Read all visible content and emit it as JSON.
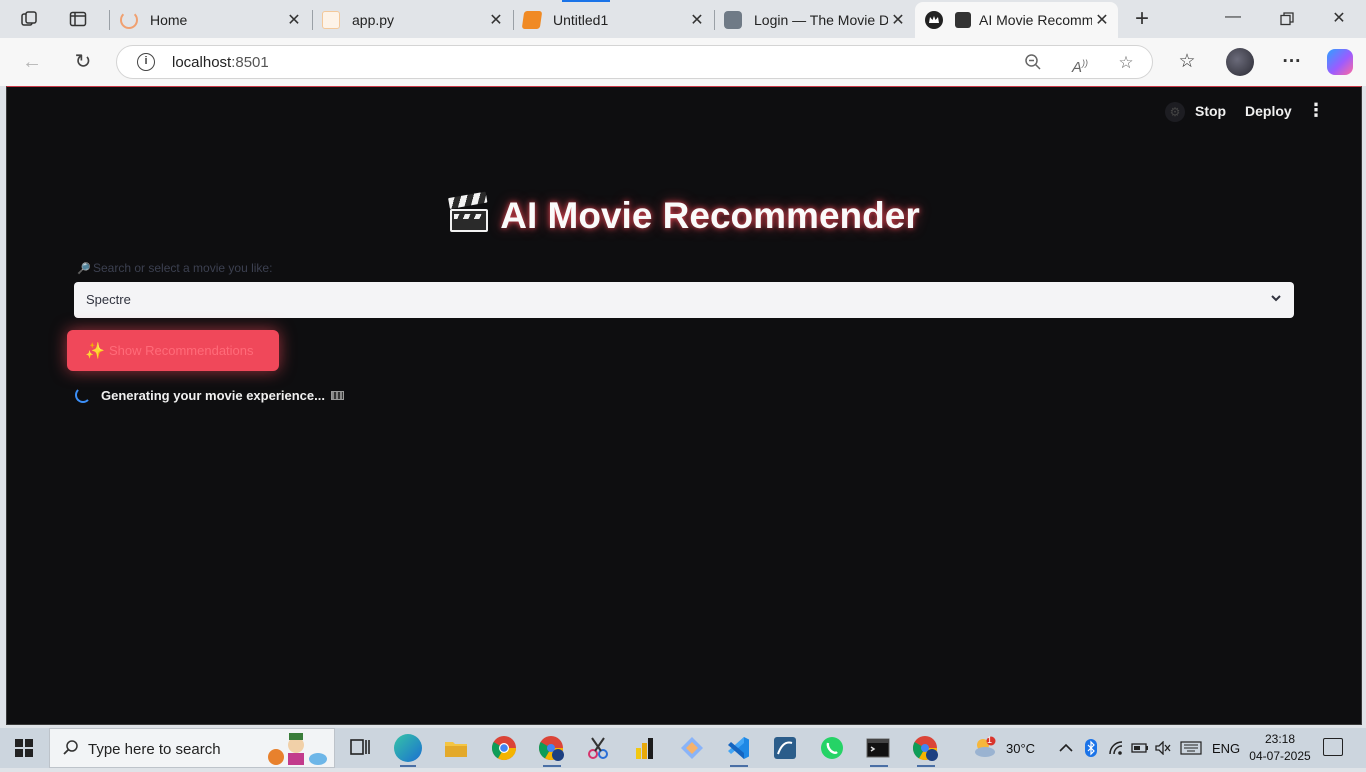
{
  "browser": {
    "tabs": [
      {
        "title": "Home",
        "favicon": "loading-spinner-icon",
        "active": false
      },
      {
        "title": "app.py",
        "favicon": "file-icon",
        "active": false
      },
      {
        "title": "Untitled1",
        "favicon": "notebook-icon",
        "active": false
      },
      {
        "title": "Login — The Movie D",
        "favicon": "tmdb-icon",
        "active": false
      },
      {
        "title": "AI Movie Recomm",
        "favicon": "streamlit-crown-icon",
        "active": true
      }
    ],
    "url_host": "localhost",
    "url_port": ":8501",
    "info_icon_glyph": "i"
  },
  "streamlit": {
    "stop_label": "Stop",
    "deploy_label": "Deploy"
  },
  "app": {
    "title": "AI Movie Recommender",
    "select_label": "Search or select a movie you like:",
    "selected_movie": "Spectre",
    "button_label": "Show Recommendations",
    "spinner_text": "Generating your movie experience..."
  },
  "taskbar": {
    "search_placeholder": "Type here to search",
    "weather": "30°C",
    "language": "ENG",
    "time": "23:18",
    "date": "04-07-2025",
    "weather_badge": "1"
  },
  "colors": {
    "accent": "#f0485a",
    "page_bg": "#0e0e10",
    "spinner": "#3c8ff7"
  }
}
